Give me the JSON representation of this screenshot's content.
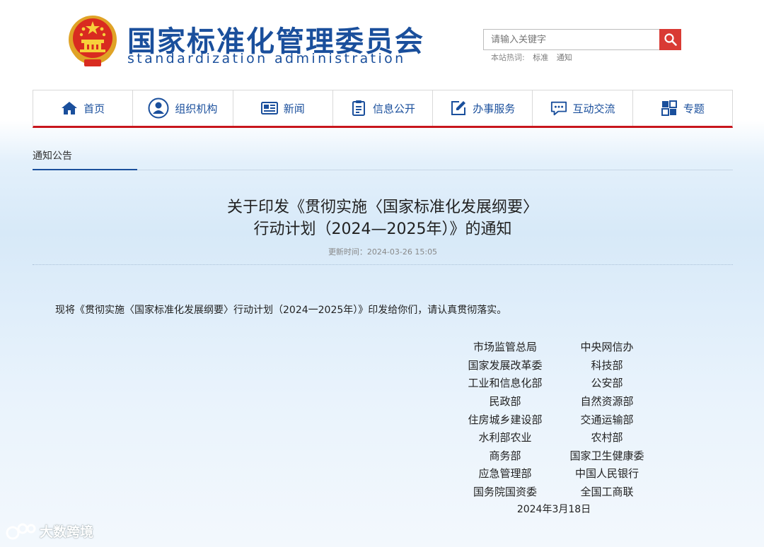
{
  "header": {
    "title_cn": "国家标准化管理委员会",
    "title_en": "standardization administration",
    "search_placeholder": "请输入关键字",
    "hot_label": "本站热词:",
    "hot_words": [
      "标准",
      "通知"
    ]
  },
  "nav": [
    {
      "label": "首页",
      "icon": "home-icon"
    },
    {
      "label": "组织机构",
      "icon": "person-icon"
    },
    {
      "label": "新闻",
      "icon": "newspaper-icon"
    },
    {
      "label": "信息公开",
      "icon": "clipboard-icon"
    },
    {
      "label": "办事服务",
      "icon": "edit-icon"
    },
    {
      "label": "互动交流",
      "icon": "chat-icon"
    },
    {
      "label": "专题",
      "icon": "topic-icon"
    }
  ],
  "breadcrumb": "通知公告",
  "article": {
    "title_line1": "关于印发《贯彻实施〈国家标准化发展纲要〉",
    "title_line2": "行动计划（2024—2025年）》的通知",
    "updated": "更新时间：2024-03-26 15:05",
    "body": "现将《贯彻实施〈国家标准化发展纲要〉行动计划（2024一2025年）》印发给你们，请认真贯彻落实。",
    "signers": [
      [
        "市场监管总局",
        "中央网信办"
      ],
      [
        "国家发展改革委",
        "科技部"
      ],
      [
        "工业和信息化部",
        "公安部"
      ],
      [
        "民政部",
        "自然资源部"
      ],
      [
        "住房城乡建设部",
        "交通运输部"
      ],
      [
        "水利部农业",
        "农村部"
      ],
      [
        "商务部",
        "国家卫生健康委"
      ],
      [
        "应急管理部",
        "中国人民银行"
      ],
      [
        "国务院国资委",
        "全国工商联"
      ]
    ],
    "date": "2024年3月18日"
  },
  "watermark": "大数跨境",
  "colors": {
    "brand_blue": "#1a4f9c",
    "accent_red": "#c8161d",
    "search_red": "#d93a34"
  }
}
